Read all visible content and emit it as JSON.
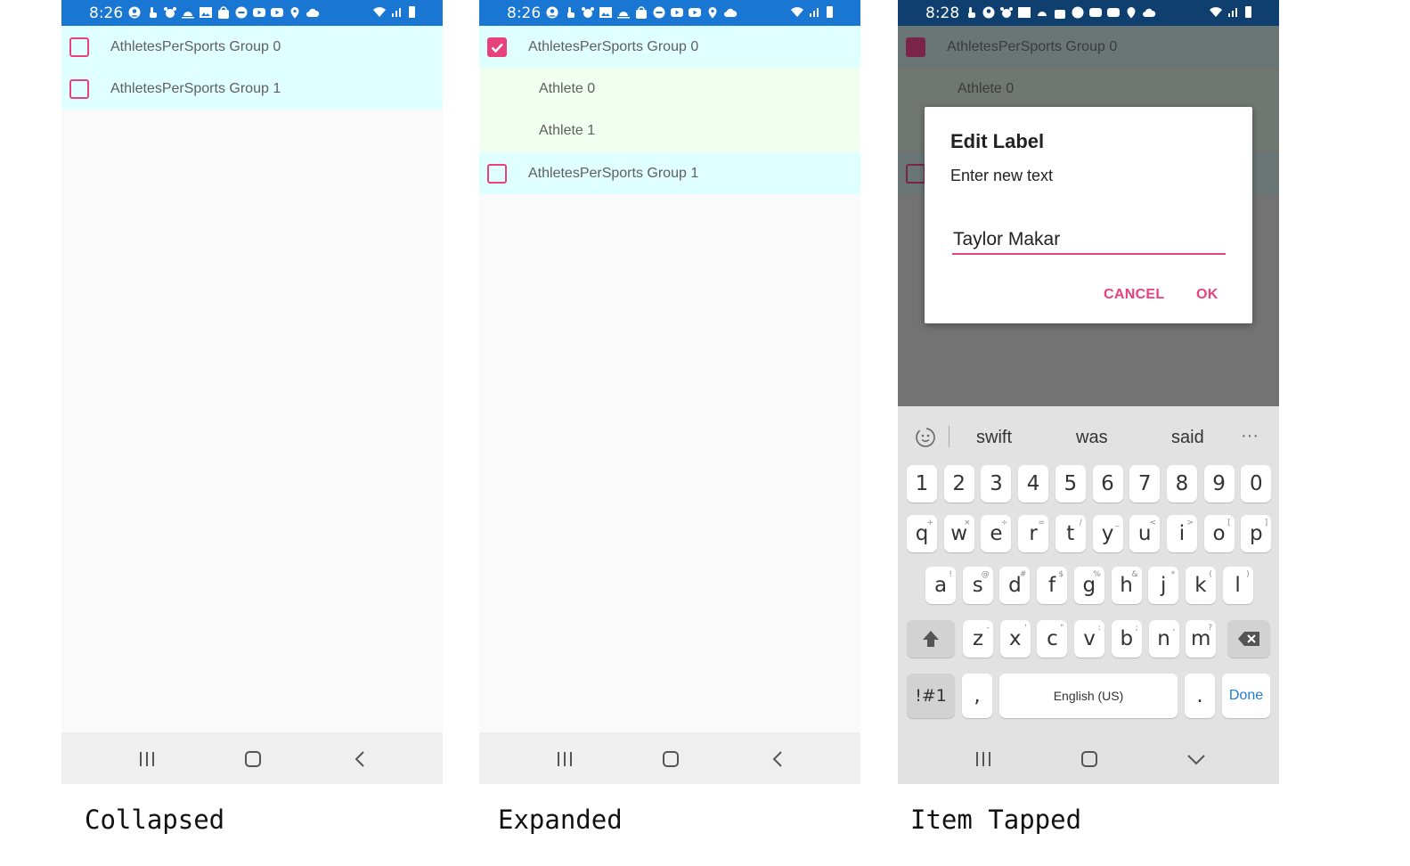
{
  "colors": {
    "status_bar": "#1976d2",
    "accent": "#e8427c",
    "group_row": "#e0ffff",
    "child_row": "#f0fff0"
  },
  "collapsed": {
    "time": "8:26",
    "rows": [
      {
        "label": "AthletesPerSports Group 0",
        "checked": false
      },
      {
        "label": "AthletesPerSports Group 1",
        "checked": false
      }
    ],
    "caption": "Collapsed"
  },
  "expanded": {
    "time": "8:26",
    "group0": "AthletesPerSports Group 0",
    "child0": "Athlete 0",
    "child1": "Athlete 1",
    "group1": "AthletesPerSports Group 1",
    "caption": "Expanded"
  },
  "tapped": {
    "time": "8:28",
    "group0": "AthletesPerSports Group 0",
    "child0": "Athlete 0",
    "dialog": {
      "title": "Edit Label",
      "message": "Enter new text",
      "input_value": "Taylor Makar",
      "cancel": "CANCEL",
      "ok": "OK"
    },
    "keyboard": {
      "suggestions": [
        "swift",
        "was",
        "said"
      ],
      "numbers": [
        "1",
        "2",
        "3",
        "4",
        "5",
        "6",
        "7",
        "8",
        "9",
        "0"
      ],
      "row1": [
        "q",
        "w",
        "e",
        "r",
        "t",
        "y",
        "u",
        "i",
        "o",
        "p"
      ],
      "row1_hints": [
        "+",
        "×",
        "÷",
        "=",
        "/",
        "_",
        "<",
        ">",
        "[",
        "]"
      ],
      "row2": [
        "a",
        "s",
        "d",
        "f",
        "g",
        "h",
        "j",
        "k",
        "l"
      ],
      "row2_hints": [
        "!",
        "@",
        "#",
        "$",
        "%",
        "&",
        "*",
        "(",
        ")"
      ],
      "row3": [
        "z",
        "x",
        "c",
        "v",
        "b",
        "n",
        "m"
      ],
      "row3_hints": [
        "-",
        "'",
        "\"",
        ":",
        ";",
        ",",
        "?"
      ],
      "sym": "!#1",
      "comma": ",",
      "space": "English (US)",
      "period": ".",
      "done": "Done"
    },
    "caption": "Item Tapped"
  }
}
